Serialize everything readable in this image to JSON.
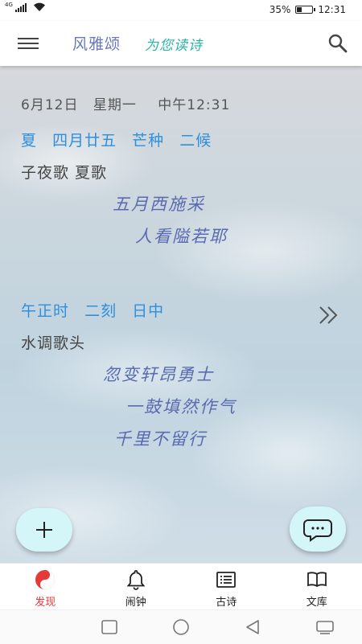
{
  "status_bar": {
    "network": "4G",
    "battery_text": "35%",
    "battery_level": 0.35,
    "time": "12:31"
  },
  "app_bar": {
    "title": "风雅颂",
    "subtitle": "为您读诗",
    "icons": {
      "menu": "menu-icon",
      "search": "search-icon"
    }
  },
  "main": {
    "date": "6月12日",
    "weekday": "星期一",
    "time": "中午12:31",
    "lunar": [
      "夏",
      "四月廿五",
      "芒种",
      "二候"
    ],
    "poem1": {
      "title": "子夜歌 夏歌",
      "lines": [
        "五月西施采",
        "人看隘若耶"
      ]
    },
    "hour": [
      "午正时",
      "二刻",
      "日中"
    ],
    "poem2": {
      "title": "水调歌头",
      "lines": [
        "忽变轩昂勇士",
        "一鼓填然作气",
        "千里不留行"
      ]
    },
    "next_icon": "double-chevron-right-icon",
    "fab_add_icon": "plus-icon",
    "fab_chat_icon": "chat-bubble-icon"
  },
  "tabs": [
    {
      "label": "发现",
      "icon": "yin-yang-icon",
      "active": true
    },
    {
      "label": "闹钟",
      "icon": "bell-icon",
      "active": false
    },
    {
      "label": "古诗",
      "icon": "list-icon",
      "active": false
    },
    {
      "label": "文库",
      "icon": "book-icon",
      "active": false
    }
  ],
  "colors": {
    "accent_blue": "#2d8fdd",
    "poem_text": "#5a6ab0",
    "title_color": "#6a77b8",
    "subtitle_color": "#2bb3a2",
    "active_tab": "#e43a3a",
    "fab_bg": "#d4f6f8"
  }
}
